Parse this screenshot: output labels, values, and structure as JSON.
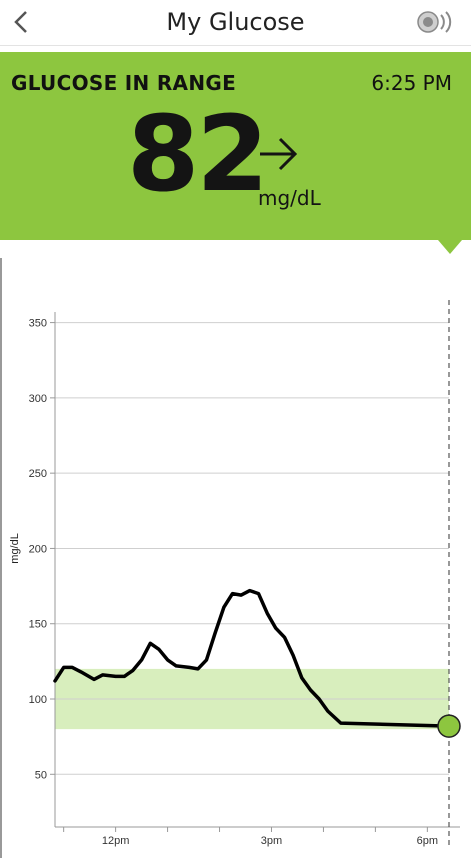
{
  "header": {
    "title": "My Glucose",
    "back_icon": "chevron-left-icon",
    "sensor_icon": "sensor-scan-icon"
  },
  "banner": {
    "status": "GLUCOSE IN RANGE",
    "time": "6:25 PM",
    "value": "82",
    "unit": "mg/dL",
    "trend_icon": "arrow-right-icon",
    "color": "#8dc63f"
  },
  "chart_data": {
    "type": "line",
    "ylabel": "mg/dL",
    "ylim": [
      15,
      365
    ],
    "y_ticks": [
      50,
      100,
      150,
      200,
      250,
      300,
      350
    ],
    "y_tick_labels": [
      "50",
      "100",
      "150",
      "200",
      "250",
      "300",
      "350"
    ],
    "x_ticks": [
      "11am",
      "12pm",
      "1pm",
      "2pm",
      "3pm",
      "4pm",
      "5pm",
      "6pm"
    ],
    "x_tick_labels": [
      "",
      "12pm",
      "",
      "",
      "3pm",
      "",
      "",
      "6pm"
    ],
    "target_range": [
      80,
      120
    ],
    "target_color": "#d8eebd",
    "current_point": {
      "x": "6:25pm",
      "y": 82
    },
    "current_color": "#8dc63f",
    "grid": true,
    "series": [
      {
        "values": [
          {
            "x": "10:50am",
            "y": 112
          },
          {
            "x": "11:00am",
            "y": 121
          },
          {
            "x": "11:10am",
            "y": 121
          },
          {
            "x": "11:20am",
            "y": 118
          },
          {
            "x": "11:35am",
            "y": 113
          },
          {
            "x": "11:45am",
            "y": 116
          },
          {
            "x": "12:00pm",
            "y": 115
          },
          {
            "x": "12:10pm",
            "y": 115
          },
          {
            "x": "12:20pm",
            "y": 119
          },
          {
            "x": "12:30pm",
            "y": 126
          },
          {
            "x": "12:40pm",
            "y": 137
          },
          {
            "x": "12:50pm",
            "y": 133
          },
          {
            "x": "1:00pm",
            "y": 126
          },
          {
            "x": "1:10pm",
            "y": 122
          },
          {
            "x": "1:25pm",
            "y": 121
          },
          {
            "x": "1:35pm",
            "y": 120
          },
          {
            "x": "1:45pm",
            "y": 126
          },
          {
            "x": "1:55pm",
            "y": 144
          },
          {
            "x": "2:05pm",
            "y": 161
          },
          {
            "x": "2:15pm",
            "y": 170
          },
          {
            "x": "2:25pm",
            "y": 169
          },
          {
            "x": "2:35pm",
            "y": 172
          },
          {
            "x": "2:45pm",
            "y": 170
          },
          {
            "x": "2:55pm",
            "y": 157
          },
          {
            "x": "3:05pm",
            "y": 147
          },
          {
            "x": "3:15pm",
            "y": 141
          },
          {
            "x": "3:25pm",
            "y": 129
          },
          {
            "x": "3:35pm",
            "y": 114
          },
          {
            "x": "3:45pm",
            "y": 106
          },
          {
            "x": "3:55pm",
            "y": 100
          },
          {
            "x": "4:05pm",
            "y": 92
          },
          {
            "x": "4:20pm",
            "y": 84
          }
        ]
      }
    ]
  }
}
